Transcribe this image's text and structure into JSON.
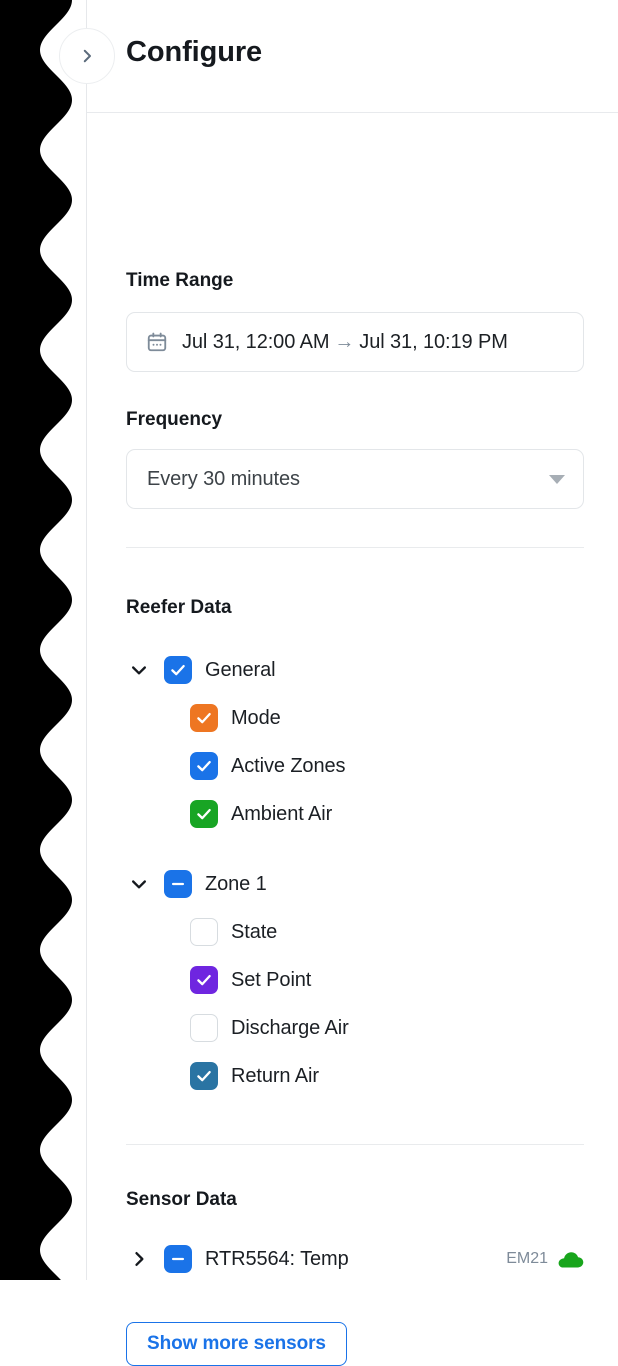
{
  "header": {
    "title": "Configure",
    "collapse_icon": "chevron-right-icon"
  },
  "time_range": {
    "label": "Time Range",
    "icon": "calendar-icon",
    "start": "Jul 31, 12:00 AM",
    "arrow": "→",
    "end": "Jul 31, 10:19 PM"
  },
  "frequency": {
    "label": "Frequency",
    "value": "Every 30 minutes",
    "caret_icon": "chevron-down-icon"
  },
  "reefer_data": {
    "title": "Reefer Data",
    "groups": [
      {
        "label": "General",
        "expanded": true,
        "twisty_icon": "chevron-down-icon",
        "checkbox_state": "checked",
        "checkbox_color": "#1a73e8",
        "children": [
          {
            "label": "Mode",
            "checkbox_state": "checked",
            "checkbox_color": "#ee7622"
          },
          {
            "label": "Active Zones",
            "checkbox_state": "checked",
            "checkbox_color": "#1a73e8"
          },
          {
            "label": "Ambient Air",
            "checkbox_state": "checked",
            "checkbox_color": "#18a524"
          }
        ]
      },
      {
        "label": "Zone 1",
        "expanded": true,
        "twisty_icon": "chevron-down-icon",
        "checkbox_state": "indeterminate",
        "checkbox_color": "#1a73e8",
        "children": [
          {
            "label": "State",
            "checkbox_state": "unchecked",
            "checkbox_color": ""
          },
          {
            "label": "Set Point",
            "checkbox_state": "checked",
            "checkbox_color": "#6f26e0"
          },
          {
            "label": "Discharge Air",
            "checkbox_state": "unchecked",
            "checkbox_color": ""
          },
          {
            "label": "Return Air",
            "checkbox_state": "checked",
            "checkbox_color": "#2a74a3"
          }
        ]
      }
    ]
  },
  "sensor_data": {
    "title": "Sensor Data",
    "rows": [
      {
        "label": "RTR5564: Temp",
        "expanded": false,
        "twisty_icon": "chevron-right-icon",
        "checkbox_state": "indeterminate",
        "checkbox_color": "#1a73e8",
        "meta_text": "EM21",
        "meta_icon": "cloud-icon",
        "meta_icon_color": "#18a51c"
      }
    ],
    "show_more_label": "Show more sensors"
  }
}
